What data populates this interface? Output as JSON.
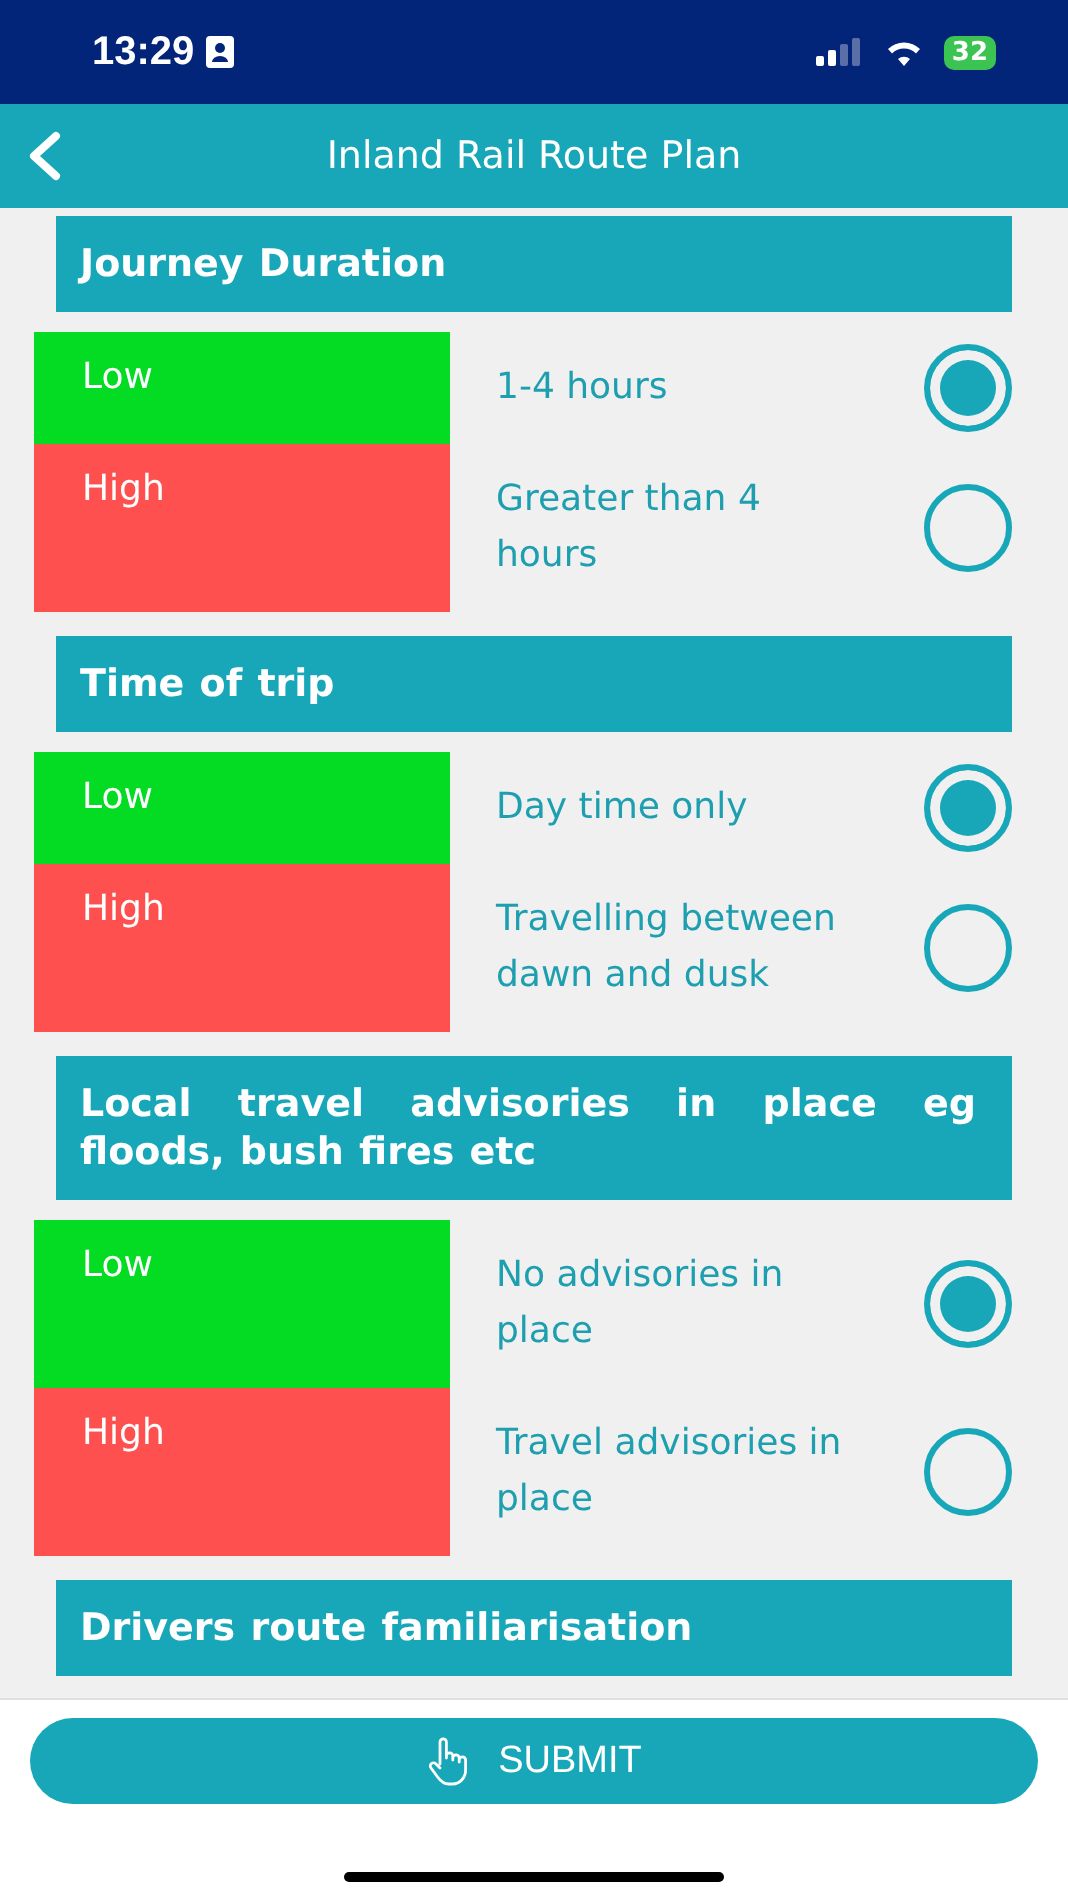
{
  "status_bar": {
    "time": "13:29",
    "battery": "32"
  },
  "header": {
    "title": "Inland Rail Route Plan"
  },
  "sections": [
    {
      "title": "Journey Duration",
      "options": [
        {
          "rating": "Low",
          "kind": "low",
          "text": "1-4 hours",
          "selected": true
        },
        {
          "rating": "High",
          "kind": "high",
          "text": "Greater than 4 hours",
          "selected": false
        }
      ]
    },
    {
      "title": "Time of trip",
      "options": [
        {
          "rating": "Low",
          "kind": "low",
          "text": "Day time only",
          "selected": true
        },
        {
          "rating": "High",
          "kind": "high",
          "text": "Travelling between dawn and dusk",
          "selected": false
        }
      ]
    },
    {
      "title": "Local travel advisories in place eg floods, bush fires etc",
      "options": [
        {
          "rating": "Low",
          "kind": "low",
          "text": "No advisories in place",
          "selected": true
        },
        {
          "rating": "High",
          "kind": "high",
          "text": "Travel advisories in place",
          "selected": false
        }
      ]
    },
    {
      "title": "Drivers route familiarisation"
    }
  ],
  "submit_button": {
    "label": "SUBMIT"
  }
}
